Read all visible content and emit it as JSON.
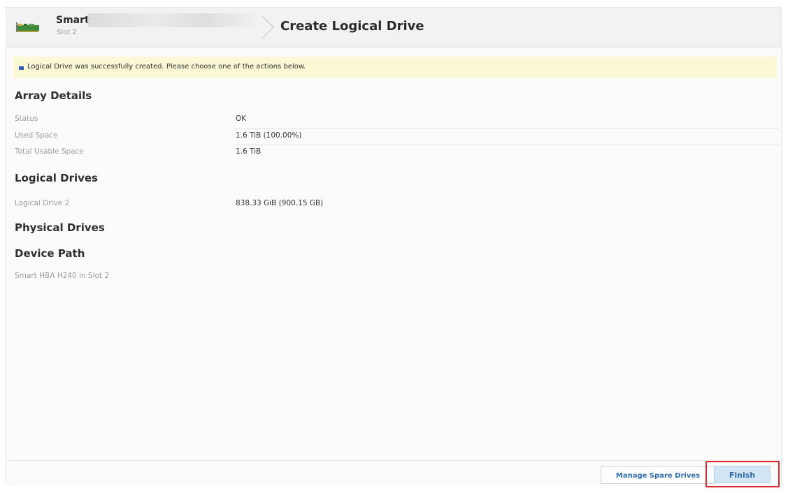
{
  "header": {
    "controller_name": "Smart",
    "slot": "Slot 2",
    "page_title": "Create Logical Drive",
    "icon": "controller-card-icon"
  },
  "banner": {
    "text": "Logical Drive was successfully created. Please choose one of the actions below."
  },
  "array_details": {
    "title": "Array Details",
    "rows": [
      {
        "label": "Status",
        "value": "OK"
      },
      {
        "label": "Used Space",
        "value": "1.6 TiB (100.00%)"
      },
      {
        "label": "Total Usable Space",
        "value": "1.6 TiB"
      }
    ]
  },
  "logical_drives": {
    "title": "Logical Drives",
    "rows": [
      {
        "label": "Logical Drive 2",
        "value": "838.33 GiB (900.15 GB)"
      }
    ]
  },
  "physical_drives": {
    "title": "Physical Drives"
  },
  "device_path": {
    "title": "Device Path",
    "value": "Smart HBA H240 in Slot 2"
  },
  "footer": {
    "manage_spare_label": "Manage Spare Drives",
    "finish_label": "Finish"
  },
  "colors": {
    "banner_bg": "#fbf8d6",
    "accent_blue": "#2d6aa8",
    "highlight_red": "#e0282e"
  }
}
